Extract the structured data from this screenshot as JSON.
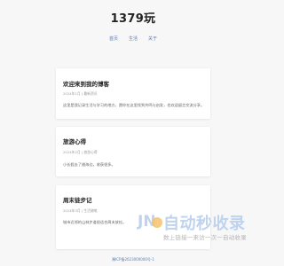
{
  "site": {
    "title": "1379玩"
  },
  "nav": {
    "items": [
      "首页",
      "生活",
      "关于"
    ]
  },
  "posts": [
    {
      "title": "欢迎来到我的博客",
      "meta": "2024年1月 | 最新资讯",
      "excerpt": "这里是我记录生活与学习的地方，愿你在这里找到共鸣与启发，也欢迎留言交流分享。"
    },
    {
      "title": "旅游心得",
      "meta": "2024年2月 | 旅游心得",
      "excerpt": "小长假去了趟海边，收获很多。"
    },
    {
      "title": "周末徒步记",
      "meta": "2024年3月 | 生活随笔",
      "excerpt": "城市近郊的山林步道很适合周末放松，"
    }
  ],
  "footer": {
    "icp": "豫ICP备2023000000号-1"
  },
  "watermark": {
    "logo_text": "JN",
    "title": "自动秒收录",
    "slogan": "数上链接一来访一次一自动收录"
  }
}
